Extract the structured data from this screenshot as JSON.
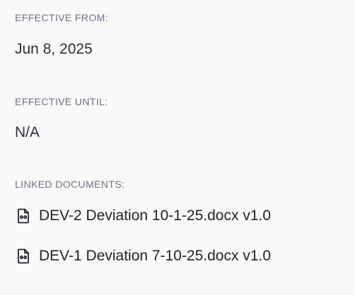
{
  "effective_from": {
    "label": "EFFECTIVE FROM:",
    "value": "Jun 8, 2025"
  },
  "effective_until": {
    "label": "EFFECTIVE UNTIL:",
    "value": "N/A"
  },
  "linked_documents": {
    "label": "LINKED DOCUMENTS:",
    "items": [
      {
        "name": "DEV-2 Deviation 10-1-25.docx v1.0",
        "icon": "file-link-icon"
      },
      {
        "name": "DEV-1 Deviation 7-10-25.docx v1.0",
        "icon": "file-link-icon"
      }
    ]
  }
}
